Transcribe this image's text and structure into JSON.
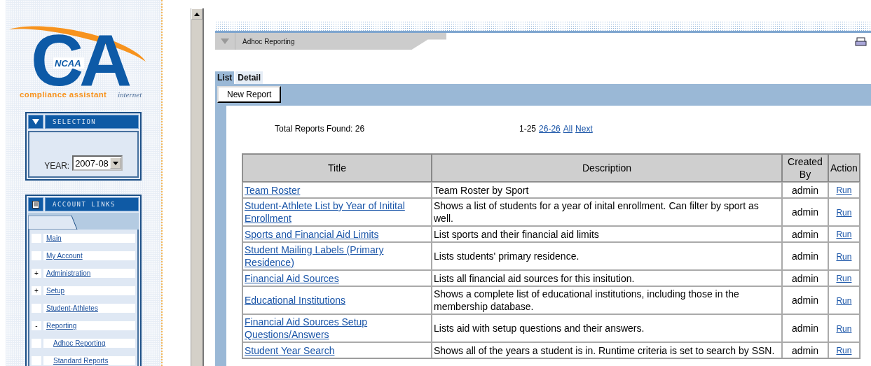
{
  "logo": {
    "mark": "CA",
    "badge": "NCAA",
    "tagline": "compliance assistant",
    "suffix": "internet"
  },
  "selection_panel": {
    "title": "SELECTION",
    "year_label": "YEAR:",
    "year_value": "2007-08"
  },
  "account_links": {
    "title": "ACCOUNT LINKS",
    "items": [
      {
        "label": "Main"
      },
      {
        "label": "My Account"
      },
      {
        "label": "Administration",
        "toggle": "+"
      },
      {
        "label": "Setup",
        "toggle": "+"
      },
      {
        "label": "Student-Athletes"
      },
      {
        "label": "Reporting",
        "toggle": "-",
        "children": [
          {
            "label": "Adhoc Reporting"
          },
          {
            "label": "Standard Reports"
          }
        ]
      }
    ]
  },
  "section_tab": {
    "title": "Adhoc Reporting"
  },
  "tabs": [
    {
      "label": "List",
      "selected": true
    },
    {
      "label": "Detail",
      "selected": false
    }
  ],
  "new_report_button": "New Report",
  "summary": "Total Reports Found: 26",
  "pagination": {
    "current": "1-25",
    "links": [
      "26-26",
      "All",
      "Next"
    ]
  },
  "table": {
    "columns": [
      "Title",
      "Description",
      "Created By",
      "Action"
    ],
    "rows": [
      {
        "title": "Team Roster",
        "description": "Team Roster by Sport",
        "created_by": "admin",
        "action": "Run"
      },
      {
        "title": "Student-Athlete List by Year of Initital Enrollment",
        "description": "Shows a list of students for a year of inital enrollment. Can filter by sport as well.",
        "created_by": "admin",
        "action": "Run"
      },
      {
        "title": "Sports and Financial Aid Limits",
        "description": "List sports and their financial aid limits",
        "created_by": "admin",
        "action": "Run"
      },
      {
        "title": "Student Mailing Labels (Primary Residence)",
        "description": "Lists students' primary residence.",
        "created_by": "admin",
        "action": "Run"
      },
      {
        "title": "Financial Aid Sources",
        "description": "Lists all financial aid sources for this insitution.",
        "created_by": "admin",
        "action": "Run"
      },
      {
        "title": "Educational Institutions",
        "description": "Shows a complete list of educational institutions, including those in the membership database.",
        "created_by": "admin",
        "action": "Run"
      },
      {
        "title": "Financial Aid Sources Setup Questions/Answers",
        "description": "Lists aid with setup questions and their answers.",
        "created_by": "admin",
        "action": "Run"
      },
      {
        "title": "Student Year Search",
        "description": "Shows all of the years a student is in. Runtime criteria is set to search by SSN.",
        "created_by": "admin",
        "action": "Run"
      }
    ]
  }
}
